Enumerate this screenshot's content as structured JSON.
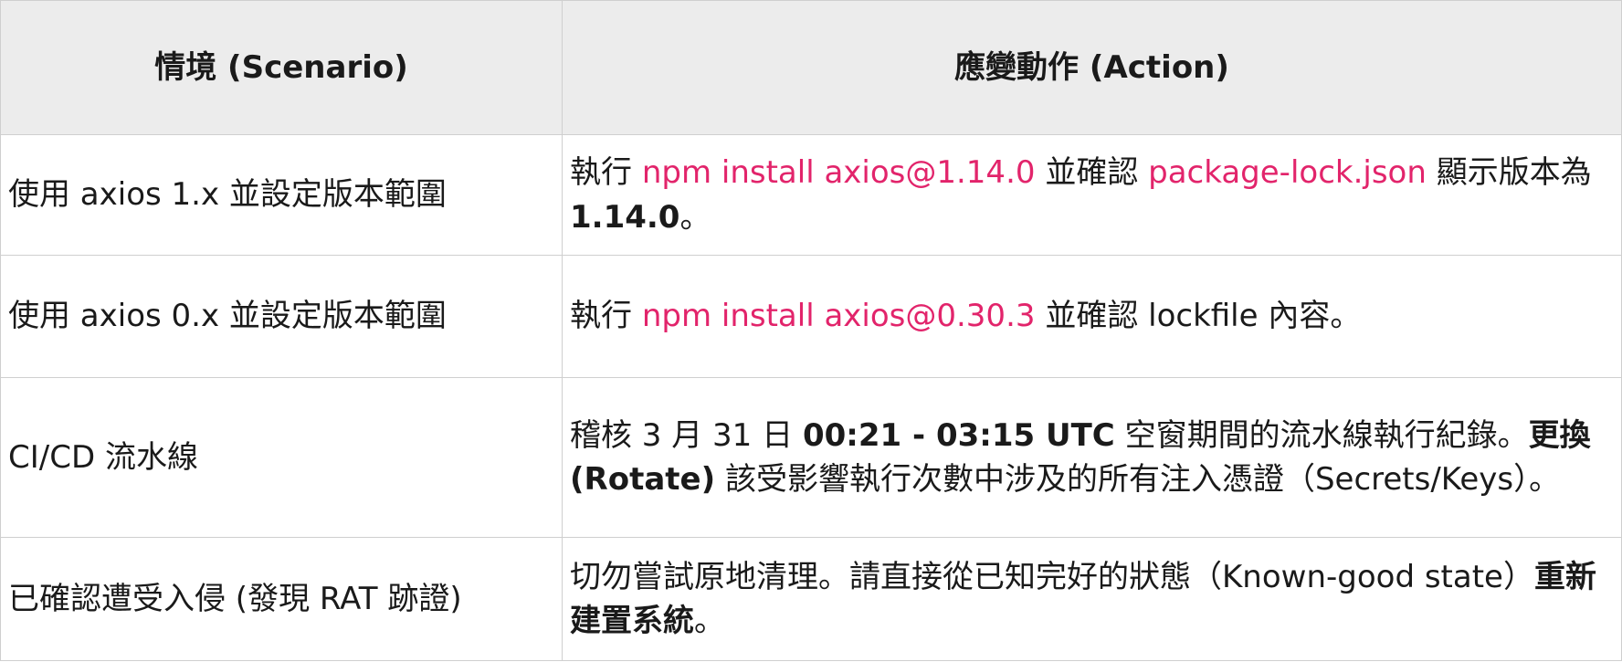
{
  "table": {
    "headers": {
      "scenario": "情境 (Scenario)",
      "action": "應變動作 (Action)"
    },
    "rows": [
      {
        "scenario": "使用 axios 1.x 並設定版本範圍",
        "action": [
          {
            "text": "執行 ",
            "style": "plain"
          },
          {
            "text": "npm install axios@1.14.0",
            "style": "code"
          },
          {
            "text": " 並確認 ",
            "style": "plain"
          },
          {
            "text": "package-lock.json",
            "style": "code"
          },
          {
            "text": " 顯示版本為 ",
            "style": "plain"
          },
          {
            "text": "1.14.0",
            "style": "strong"
          },
          {
            "text": "。",
            "style": "plain"
          }
        ]
      },
      {
        "scenario": "使用 axios 0.x 並設定版本範圍",
        "action": [
          {
            "text": "執行 ",
            "style": "plain"
          },
          {
            "text": "npm install axios@0.30.3",
            "style": "code"
          },
          {
            "text": " 並確認 lockfile 內容。",
            "style": "plain"
          }
        ]
      },
      {
        "scenario": "CI/CD 流水線",
        "action": [
          {
            "text": "稽核 3 月 31 日 ",
            "style": "plain"
          },
          {
            "text": "00:21 - 03:15 UTC",
            "style": "strong"
          },
          {
            "text": " 空窗期間的流水線執行紀錄。",
            "style": "plain"
          },
          {
            "text": "更換 (Rotate)",
            "style": "strong"
          },
          {
            "text": " 該受影響執行次數中涉及的所有注入憑證（Secrets/Keys）。",
            "style": "plain"
          }
        ]
      },
      {
        "scenario": "已確認遭受入侵 (發現 RAT 跡證)",
        "action": [
          {
            "text": "切勿嘗試原地清理。請直接從已知完好的狀態（Known-good state）",
            "style": "plain"
          },
          {
            "text": "重新建置系統",
            "style": "strong"
          },
          {
            "text": "。",
            "style": "plain"
          }
        ]
      }
    ]
  },
  "colors": {
    "header_bg": "#ececec",
    "border": "#cfcfcf",
    "code_text": "#e2246b",
    "body_text": "#1a1a1a"
  }
}
